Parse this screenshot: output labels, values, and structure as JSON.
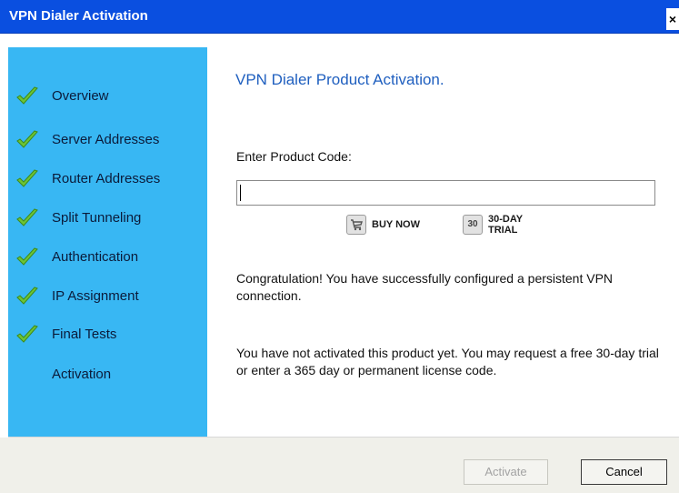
{
  "window": {
    "title": "VPN Dialer Activation",
    "close_glyph": "×"
  },
  "sidebar": {
    "items": [
      {
        "label": "Overview",
        "completed": true
      },
      {
        "label": "Server Addresses",
        "completed": true
      },
      {
        "label": "Router Addresses",
        "completed": true
      },
      {
        "label": "Split Tunneling",
        "completed": true
      },
      {
        "label": "Authentication",
        "completed": true
      },
      {
        "label": "IP Assignment",
        "completed": true
      },
      {
        "label": "Final Tests",
        "completed": true
      },
      {
        "label": "Activation",
        "completed": false
      }
    ],
    "check_icon": "green-checkmark-icon"
  },
  "main": {
    "heading": "VPN Dialer Product Activation.",
    "code_label": "Enter Product Code:",
    "code_value": "",
    "buy_now": {
      "label": "BUY NOW",
      "icon": "cart-icon"
    },
    "trial": {
      "label_line1": "30-DAY",
      "label_line2": "TRIAL",
      "icon": "calendar-30-icon",
      "icon_text": "30"
    },
    "message1": "Congratulation! You have successfully configured a persistent VPN connection.",
    "message2": "You have not activated this product yet. You may request a free 30-day trial or enter a 365 day or permanent license code."
  },
  "footer": {
    "activate_label": "Activate",
    "activate_enabled": false,
    "cancel_label": "Cancel"
  },
  "colors": {
    "titlebar": "#0a4fe0",
    "sidebar": "#38b7f3",
    "heading": "#1f5fbf",
    "check": "#5cb82e",
    "footer": "#f0f0ea"
  }
}
